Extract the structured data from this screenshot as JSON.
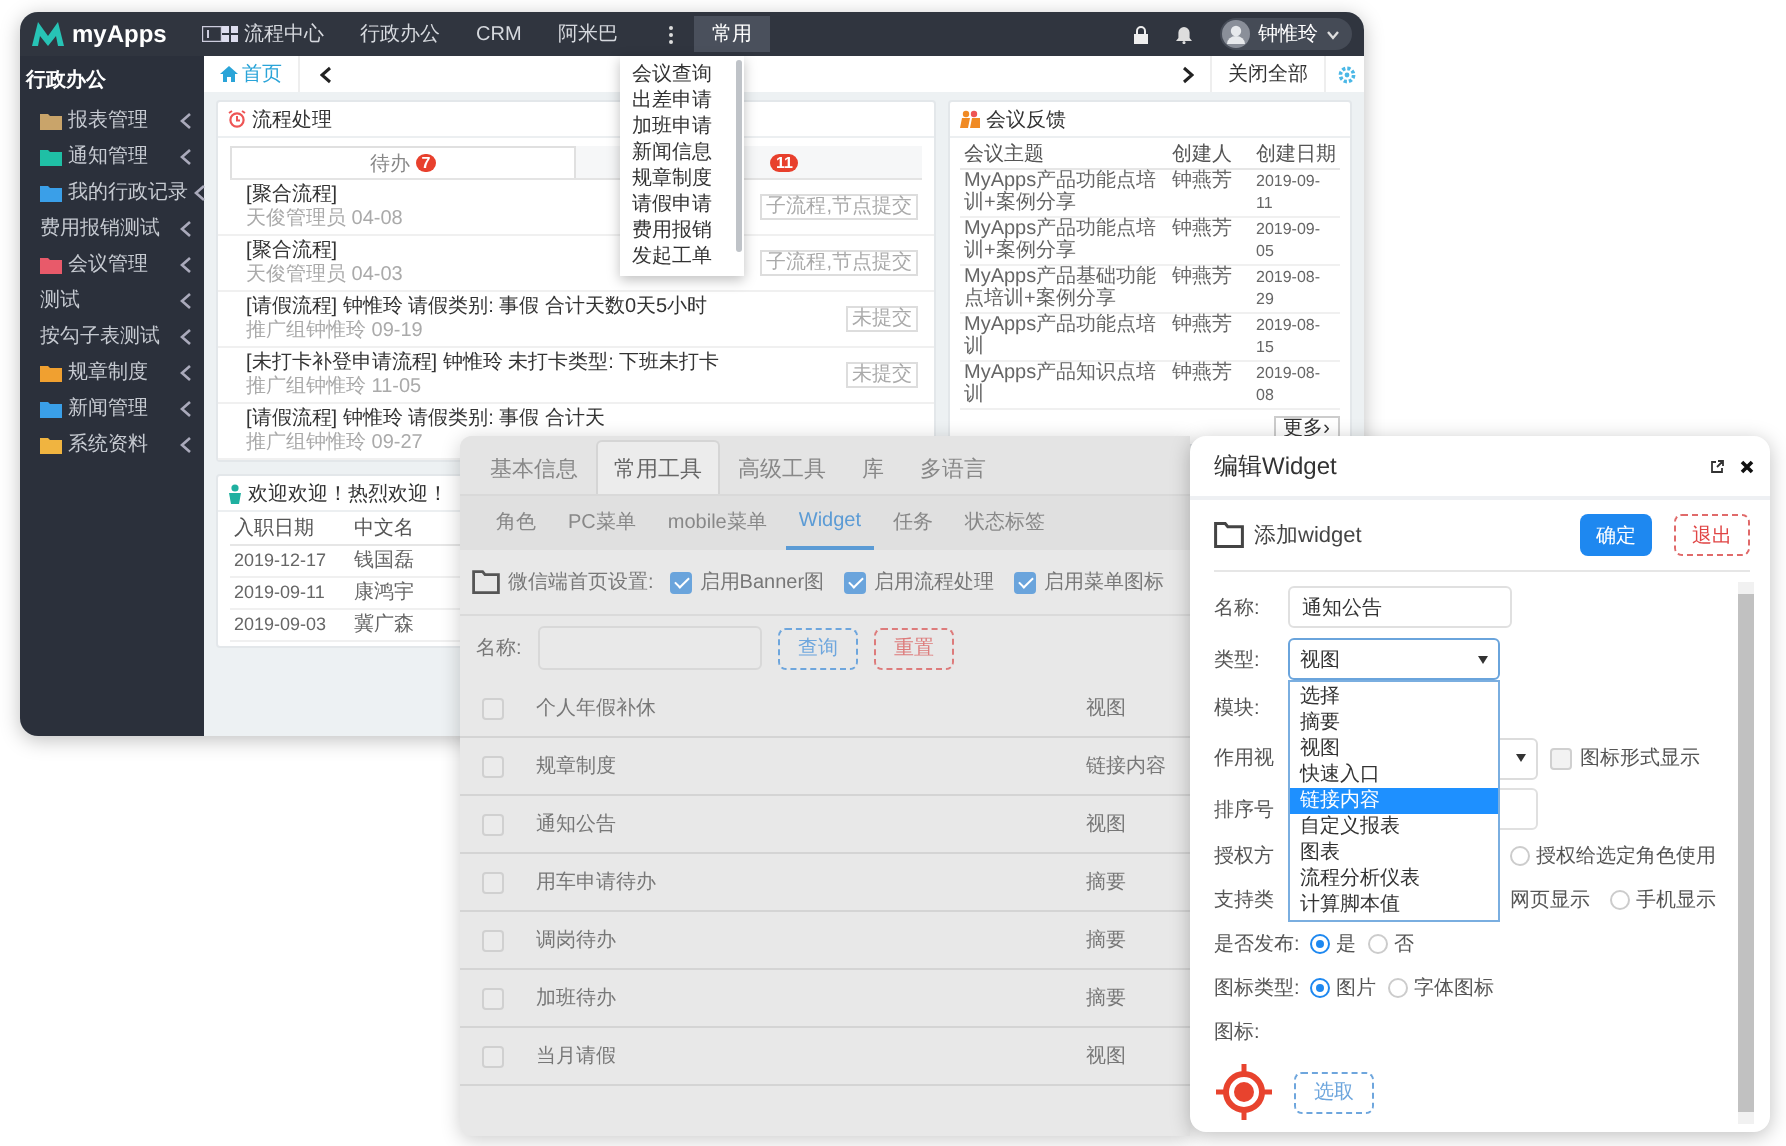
{
  "back_window": {
    "logo": "myApps",
    "top_menu": [
      {
        "label": "流程中心",
        "kind": "grid",
        "selected": false
      },
      {
        "label": "行政办公",
        "kind": "plain",
        "selected": false
      },
      {
        "label": "CRM",
        "kind": "plain",
        "selected": false
      },
      {
        "label": "阿米巴",
        "kind": "plain",
        "selected": false
      },
      {
        "label": "常用",
        "kind": "dropdown",
        "selected": true,
        "menu": [
          "会议查询",
          "出差申请",
          "加班申请",
          "新闻信息",
          "规章制度",
          "请假申请",
          "费用报销",
          "发起工单"
        ]
      }
    ],
    "user": "钟惟玲",
    "sidebar": {
      "title": "行政办公",
      "items": [
        {
          "label": "报表管理",
          "color": "#c9a46a"
        },
        {
          "label": "通知管理",
          "color": "#1fbfa5"
        },
        {
          "label": "我的行政记录",
          "color": "#3a9fe8"
        },
        {
          "label": "费用报销测试"
        },
        {
          "label": "会议管理",
          "color": "#e85a6a"
        },
        {
          "label": "测试"
        },
        {
          "label": "按勾子表测试"
        },
        {
          "label": "规章制度",
          "color": "#f0a030"
        },
        {
          "label": "新闻管理",
          "color": "#3a9fe8"
        },
        {
          "label": "系统资料",
          "color": "#f0b440"
        }
      ]
    },
    "tab_strip": {
      "home_tab": "首页",
      "close_all": "关闭全部"
    },
    "process_panel": {
      "title": "流程处理",
      "tabs": [
        {
          "label": "待办",
          "badge": "7",
          "selected": true
        },
        {
          "badge": "11",
          "selected": false
        }
      ],
      "items": [
        {
          "title": "[聚合流程]",
          "meta": "天俊管理员 04-08",
          "tag": "子流程,节点提交"
        },
        {
          "title": "[聚合流程]",
          "meta": "天俊管理员 04-03",
          "tag": "子流程,节点提交"
        },
        {
          "title": "[请假流程] 钟惟玲 请假类别: 事假 合计天数0天5小时",
          "meta": "推广组钟惟玲 09-19",
          "tag": "未提交"
        },
        {
          "title": "[未打卡补登申请流程] 钟惟玲 未打卡类型: 下班未打卡",
          "meta": "推广组钟惟玲 11-05",
          "tag": "未提交"
        },
        {
          "title": "[请假流程] 钟惟玲 请假类别: 事假 合计天",
          "meta": "推广组钟惟玲 09-27"
        }
      ]
    },
    "welcome_panel": {
      "title": "欢迎欢迎！热烈欢迎！",
      "columns": [
        "入职日期",
        "中文名"
      ],
      "rows": [
        [
          "2019-12-17",
          "钱国磊"
        ],
        [
          "2019-09-11",
          "康鸿宇"
        ],
        [
          "2019-09-03",
          "冀广森"
        ]
      ]
    },
    "meeting_panel": {
      "title": "会议反馈",
      "columns": [
        "会议主题",
        "创建人",
        "创建日期"
      ],
      "rows": [
        [
          "MyApps产品功能点培训+案例分享",
          "钟燕芳",
          "2019-09-11"
        ],
        [
          "MyApps产品功能点培训+案例分享",
          "钟燕芳",
          "2019-09-05"
        ],
        [
          "MyApps产品基础功能点培训+案例分享",
          "钟燕芳",
          "2019-08-29"
        ],
        [
          "MyApps产品功能点培训",
          "钟燕芳",
          "2019-08-15"
        ],
        [
          "MyApps产品知识点培训",
          "钟燕芳",
          "2019-08-08"
        ]
      ],
      "more_button": "更多›"
    }
  },
  "tool_panel": {
    "tabs": [
      {
        "label": "基本信息",
        "selected": false
      },
      {
        "label": "常用工具",
        "selected": true
      },
      {
        "label": "高级工具",
        "selected": false
      },
      {
        "label": "库",
        "selected": false
      },
      {
        "label": "多语言",
        "selected": false
      }
    ],
    "subtabs": [
      {
        "label": "角色",
        "selected": false
      },
      {
        "label": "PC菜单",
        "selected": false
      },
      {
        "label": "mobile菜单",
        "selected": false
      },
      {
        "label": "Widget",
        "selected": true
      },
      {
        "label": "任务",
        "selected": false
      },
      {
        "label": "状态标签",
        "selected": false
      }
    ],
    "settings": {
      "label": "微信端首页设置:",
      "options": [
        {
          "label": "启用Banner图",
          "checked": true
        },
        {
          "label": "启用流程处理",
          "checked": true
        },
        {
          "label": "启用菜单图标",
          "checked": true
        }
      ]
    },
    "search": {
      "label": "名称:",
      "query_button": "查询",
      "reset_button": "重置"
    },
    "rows": [
      {
        "name": "个人年假补休",
        "type": "视图",
        "checked": false
      },
      {
        "name": "规章制度",
        "type": "链接内容",
        "checked": false
      },
      {
        "name": "通知公告",
        "type": "视图",
        "checked": false
      },
      {
        "name": "用车申请待办",
        "type": "摘要",
        "checked": false
      },
      {
        "name": "调岗待办",
        "type": "摘要",
        "checked": false
      },
      {
        "name": "加班待办",
        "type": "摘要",
        "checked": false
      },
      {
        "name": "当月请假",
        "type": "视图",
        "checked": false
      }
    ]
  },
  "dialog": {
    "title": "编辑Widget",
    "heading": "添加widget",
    "confirm_button": "确定",
    "exit_button": "退出",
    "form": [
      {
        "kind": "input",
        "label": "名称:",
        "value": "通知公告"
      },
      {
        "kind": "select",
        "label": "类型:",
        "value": "视图",
        "expanded": true,
        "options": [
          {
            "label": "选择",
            "highlighted": false
          },
          {
            "label": "摘要",
            "highlighted": false
          },
          {
            "label": "视图",
            "highlighted": false
          },
          {
            "label": "快速入口",
            "highlighted": false
          },
          {
            "label": "链接内容",
            "highlighted": true
          },
          {
            "label": "自定义报表",
            "highlighted": false
          },
          {
            "label": "图表",
            "highlighted": false
          },
          {
            "label": "流程分析仪表",
            "highlighted": false
          },
          {
            "label": "计算脚本值",
            "highlighted": false
          }
        ]
      },
      {
        "kind": "blank",
        "label": "模块:"
      },
      {
        "kind": "select_check",
        "label": "作用视",
        "check": {
          "label": "图标形式显示",
          "checked": false
        }
      },
      {
        "kind": "input",
        "label": "排序号"
      },
      {
        "kind": "radios",
        "label": "授权方",
        "options": [
          {
            "label": "授权给选定角色使用",
            "selected": false
          }
        ]
      },
      {
        "kind": "radios",
        "label": "支持类",
        "note": "网页显示",
        "options": [
          {
            "label": "手机显示",
            "selected": false
          }
        ]
      },
      {
        "kind": "radios",
        "label": "是否发布:",
        "options": [
          {
            "label": "是",
            "selected": true
          },
          {
            "label": "否",
            "selected": false
          }
        ]
      },
      {
        "kind": "radios",
        "label": "图标类型:",
        "options": [
          {
            "label": "图片",
            "selected": true
          },
          {
            "label": "字体图标",
            "selected": false
          }
        ]
      },
      {
        "kind": "icon",
        "label": "图标:",
        "button": "选取"
      }
    ]
  }
}
